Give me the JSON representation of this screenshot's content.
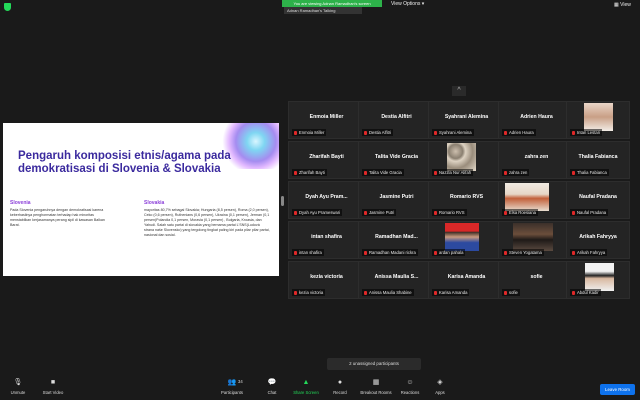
{
  "top": {
    "viewing_banner": "You are viewing Adnan Ramadhan's screen",
    "speaker_label": "Adnan Ramadhan's Talking",
    "view_options_label": "View Options",
    "view_options_chevron": "▾",
    "view_button_label": "View"
  },
  "slide": {
    "title": "Pengaruh komposisi etnis/agama pada demokratisasi di Slovenia & Slovakia",
    "left_heading": "Slovenia",
    "left_text": "Pada Slovenia pengaruhnya dengan demokratisasi karena keberhasilnya penghormatan terhadap hak minoritas menstabilkan kerjasamanya perang sipil di kawasan Balkan Barat.",
    "right_heading": "Slovakia",
    "right_text": "mayoritas 80,7% sebagai Slovakia; Hungaria (8,5 persen), Roma (2,0 persen), Ceko (0,6 persen), Ruthenians (0,6 persen), Ukraina (0,1 persen), Jerman (0,1 persen)Polandia 0,1 persen, Moravia (0,1 persen) , Bulgaria, Kroasia, dan Yahudi. Salah satu partai di slovakia yang bernama partai L'SNS(Ludová strana naše Slovensko) yang tergolong tingkat paling kiri pada pilar pilar partai, nasional dan sosial."
  },
  "gallery": {
    "scroll_up": "^",
    "participants": [
      {
        "big": "Enmoia Miller",
        "label": "Enmoia Miller"
      },
      {
        "big": "Destia Alfitri",
        "label": "Destia Alfitri"
      },
      {
        "big": "Syahrani Alemina",
        "label": "Syahrani Alemina"
      },
      {
        "big": "Adrien Haura",
        "label": "Adrien Haura"
      },
      {
        "big": "",
        "label": "Intan Lestari"
      },
      {
        "big": "Zharifah Bayti",
        "label": "Zharifah Bayti"
      },
      {
        "big": "Talita Vide Gracia",
        "label": "Talita Vide Gracia"
      },
      {
        "big": "",
        "label": "Nazzla Nur Alifah"
      },
      {
        "big": "zahra zen",
        "label": "zahra zen"
      },
      {
        "big": "Thalia Fabianca",
        "label": "Thalia Fabianca"
      },
      {
        "big": "Dyah Ayu Pram...",
        "label": "Dyah Ayu Prameswari"
      },
      {
        "big": "Jasmine Putri",
        "label": "Jasmine Putri"
      },
      {
        "big": "Romario RVS",
        "label": "Romario RVS"
      },
      {
        "big": "",
        "label": "Elsa Roesiana"
      },
      {
        "big": "Naufal Pradana",
        "label": "Naufal Pradana"
      },
      {
        "big": "intan shafira",
        "label": "intan shafira"
      },
      {
        "big": "Ramadhan Mad...",
        "label": "Ramadhan Madani rickra"
      },
      {
        "big": "",
        "label": "ardan pahala"
      },
      {
        "big": "",
        "label": "Steven Yogatama"
      },
      {
        "big": "Arikah Fahryya",
        "label": "Arikah Fahryya"
      },
      {
        "big": "kezia victoria",
        "label": "kezia victoria"
      },
      {
        "big": "Anissa Maulia S...",
        "label": "Anissa Maulia Shabine"
      },
      {
        "big": "Karisa Amanda",
        "label": "Karisa Amanda"
      },
      {
        "big": "sofie",
        "label": "sofie"
      },
      {
        "big": "",
        "label": "Abdul Kadir"
      }
    ],
    "unassigned_label": "2 unassigned participants"
  },
  "toolbar": {
    "unmute": "Unmute",
    "start_video": "Start Video",
    "participants": "Participants",
    "participants_count": "34",
    "chat": "Chat",
    "share_screen": "Share Screen",
    "record": "Record",
    "breakout_rooms": "Breakout Rooms",
    "reactions": "Reactions",
    "apps": "Apps",
    "leave": "Leave Room"
  },
  "colors": {
    "accent_green": "#23d959",
    "leave_blue": "#0e72ed",
    "slide_title": "#3b2a9e",
    "slide_heading": "#8b3fd9",
    "muted_red": "#e02828"
  }
}
